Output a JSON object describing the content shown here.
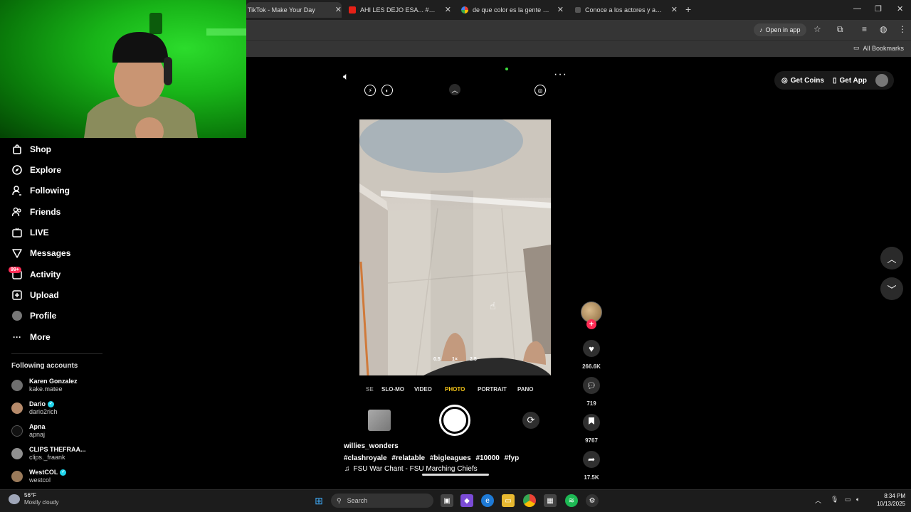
{
  "browser": {
    "tabs": [
      {
        "title": "TikTok - Make Your Day",
        "active": true
      },
      {
        "title": "AHI LES DEJO ESA... #chenteydi",
        "active": false
      },
      {
        "title": "de que color es la gente de aus",
        "active": false
      },
      {
        "title": "Conoce a los actores y actrices",
        "active": false
      }
    ],
    "open_in_app": "Open in app",
    "all_bookmarks": "All Bookmarks"
  },
  "sidebar": {
    "items": [
      {
        "label": "Shop",
        "icon": "shop-bag-icon"
      },
      {
        "label": "Explore",
        "icon": "compass-icon"
      },
      {
        "label": "Following",
        "icon": "person-follow-icon"
      },
      {
        "label": "Friends",
        "icon": "friends-icon"
      },
      {
        "label": "LIVE",
        "icon": "live-tv-icon"
      },
      {
        "label": "Messages",
        "icon": "paper-plane-icon"
      },
      {
        "label": "Activity",
        "icon": "heart-activity-icon",
        "badge": "99+"
      },
      {
        "label": "Upload",
        "icon": "upload-plus-icon"
      },
      {
        "label": "Profile",
        "icon": "profile-icon"
      },
      {
        "label": "More",
        "icon": "more-dots-icon"
      }
    ],
    "following_title": "Following accounts",
    "accounts": [
      {
        "name": "Karen Gonzalez",
        "username": "kake.matee",
        "verified": false
      },
      {
        "name": "Dario",
        "username": "dario2rich",
        "verified": true
      },
      {
        "name": "Apna",
        "username": "apnaj",
        "verified": false
      },
      {
        "name": "CLIPS THEFRAA...",
        "username": "clips._fraank",
        "verified": false
      },
      {
        "name": "WestCOL",
        "username": "westcol",
        "verified": true
      }
    ]
  },
  "video": {
    "camera_zoom": [
      "0.5",
      "1×",
      "2.5"
    ],
    "camera_modes": [
      "SE",
      "SLO-MO",
      "VIDEO",
      "PHOTO",
      "PORTRAIT",
      "PANO"
    ],
    "active_mode": "PHOTO",
    "author": "willies_wonders",
    "hashtags": [
      "#clashroyale",
      "#relatable",
      "#bigleagues",
      "#10000",
      "#fyp"
    ],
    "music": "FSU War Chant - FSU Marching Chiefs"
  },
  "actions": {
    "likes": "266.6K",
    "comments": "719",
    "saves": "9767",
    "shares": "17.5K"
  },
  "header_buttons": {
    "get_coins": "Get Coins",
    "get_app": "Get App"
  },
  "taskbar": {
    "weather_temp": "56°F",
    "weather_desc": "Mostly cloudy",
    "search": "Search",
    "time": "8:34 PM",
    "date": "10/13/2025"
  },
  "colors": {
    "tiktok_red": "#fe2c55",
    "verified_cyan": "#20d5ec",
    "mode_active": "#f5c518",
    "greenscreen": "#18b418"
  }
}
